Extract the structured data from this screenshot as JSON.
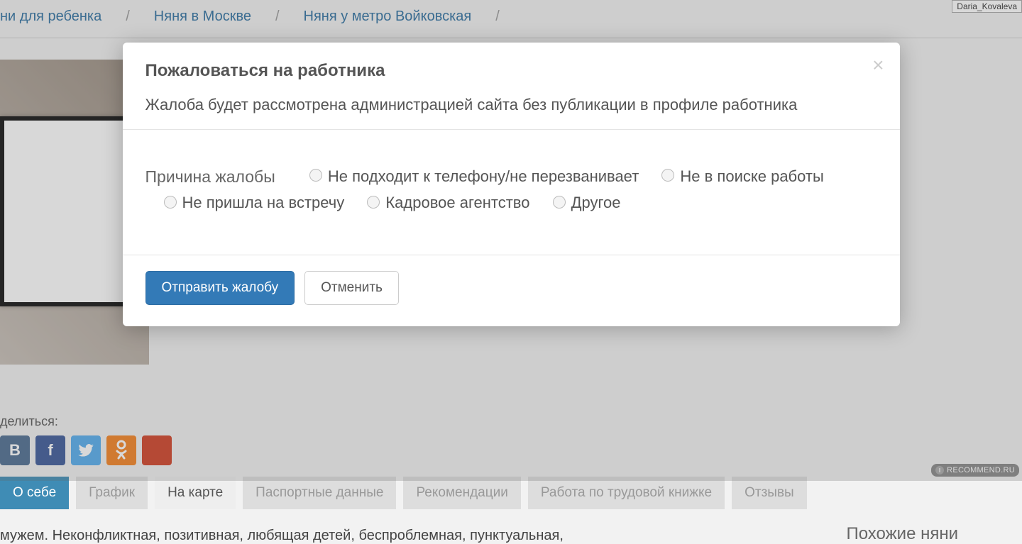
{
  "user_badge": "Daria_Kovaleva",
  "breadcrumbs": {
    "items": [
      "ни для ребенка",
      "Няня в Москве",
      "Няня у метро Войковская"
    ],
    "sep": "/"
  },
  "share_label": "делиться:",
  "social": {
    "vk": "B",
    "fb": "f",
    "tw": "",
    "ok": "",
    "gp": ""
  },
  "tabs": [
    "О себе",
    "График",
    "На карте",
    "Паспортные данные",
    "Рекомендации",
    "Работа по трудовой книжке",
    "Отзывы"
  ],
  "description": "мужем. Неконфликтная, позитивная, любящая детей, беспроблемная, пунктуальная,",
  "sidebar_heading": "Похожие няни",
  "watermark": "RECOMMEND.RU",
  "watermark_icon": "I",
  "modal": {
    "title": "Пожаловаться на работника",
    "subtitle": "Жалоба будет рассмотрена администрацией сайта без публикации в профиле работника",
    "reason_label": "Причина жалобы",
    "options": [
      "Не подходит к телефону/не перезванивает",
      "Не в поиске работы",
      "Не пришла на встречу",
      "Кадровое агентство",
      "Другое"
    ],
    "submit": "Отправить жалобу",
    "cancel": "Отменить"
  }
}
